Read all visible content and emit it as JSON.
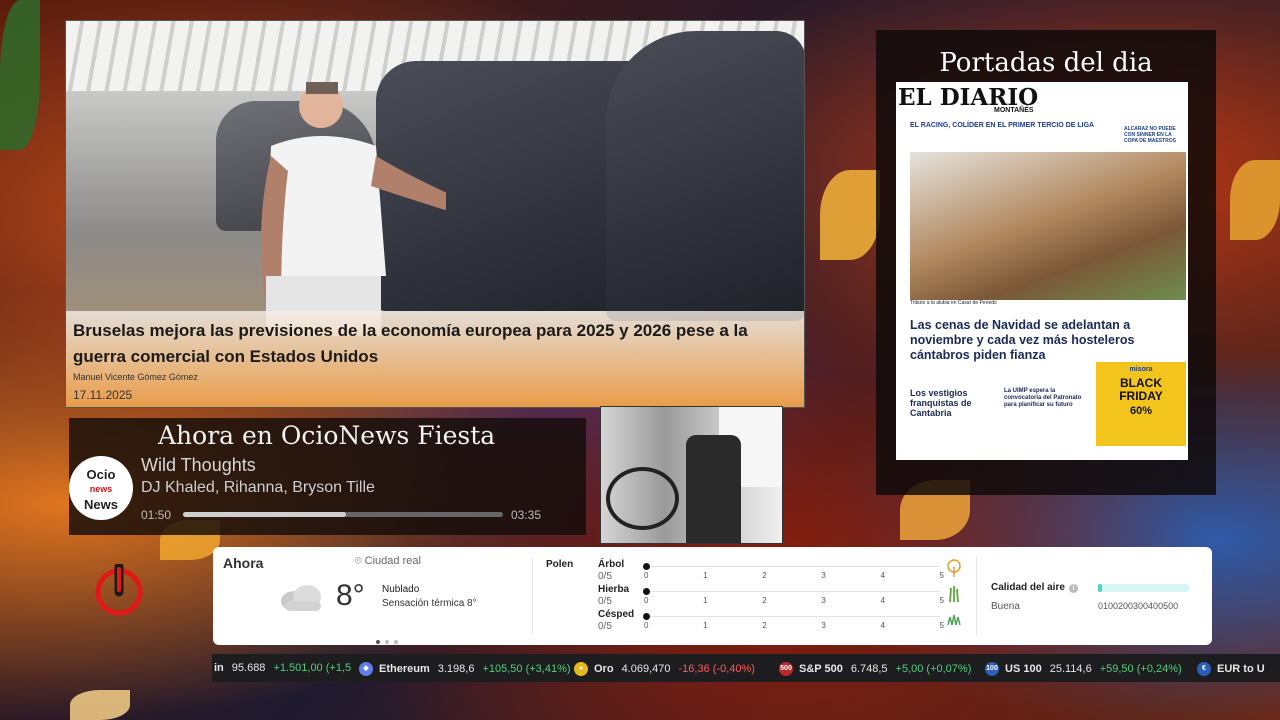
{
  "news": {
    "title": "Bruselas mejora las previsiones de la economía europea para 2025 y 2026 pese a la guerra comercial con Estados Unidos",
    "author": "Manuel Vicente Gómez Gómez",
    "date": "17.11.2025"
  },
  "portadas": {
    "title": "Portadas del dia",
    "paper_name": "EL DIARIO",
    "paper_sub": "MONTAÑÉS",
    "headline_top": "EL RACING, COLÍDER EN EL PRIMER TERCIO DE LIGA",
    "caption": "Tributo a la alubia en Casar de Periedo",
    "headline_main": "Las cenas de Navidad se adelantan a noviembre y cada vez más hosteleros cántabros piden fianza",
    "col_left": "Los vestigios franquistas de Cantabria",
    "col_mid": "La UIMP espera la convocatoria del Patronato para planificar su futuro",
    "right_top": "ALCARAZ NO PUEDE CON SINNER EN LA COPA DE MAESTROS",
    "ad_text": "BLACK FRIDAY",
    "ad_brand": "misora",
    "ad_pct": "60%"
  },
  "radio": {
    "title": "Ahora en OcioNews Fiesta",
    "logo_line1": "Ocio",
    "logo_line2": "news",
    "logo_line3": "News",
    "song": "Wild Thoughts",
    "artist": "DJ Khaled, Rihanna, Bryson Tille",
    "elapsed": "01:50",
    "duration": "03:35",
    "progress": 0.51
  },
  "weather": {
    "now_label": "Ahora",
    "city": "Ciudad real",
    "temp": "8°",
    "desc": "Nublado",
    "feels": "Sensación térmica 8°",
    "polen_label": "Polen",
    "polen": [
      {
        "name": "Árbol",
        "value": "0/5"
      },
      {
        "name": "Hierba",
        "value": "0/5"
      },
      {
        "name": "Césped",
        "value": "0/5"
      }
    ],
    "scale": [
      "0",
      "1",
      "2",
      "3",
      "4",
      "5"
    ],
    "air_label": "Calidad del aire",
    "air_state": "Buena",
    "air_scale": "0100200300400500"
  },
  "ticker": [
    {
      "name": "in",
      "value": "95.688",
      "change": "+1.501,00 (+1,5",
      "trend": "pos",
      "icon": "",
      "color": "#1d1c1f"
    },
    {
      "name": "Ethereum",
      "value": "3.198,6",
      "change": "+105,50 (+3,41%)",
      "trend": "pos",
      "icon": "◆",
      "color": "#627eea"
    },
    {
      "name": "Oro",
      "value": "4.069,470",
      "change": "-16,36 (-0,40%)",
      "trend": "neg",
      "icon": "●",
      "color": "#e5b820"
    },
    {
      "name": "S&P 500",
      "value": "6.748,5",
      "change": "+5,00 (+0,07%)",
      "trend": "pos",
      "icon": "500",
      "color": "#c0262d"
    },
    {
      "name": "US 100",
      "value": "25.114,6",
      "change": "+59,50 (+0,24%)",
      "trend": "pos",
      "icon": "100",
      "color": "#2a5fb8"
    },
    {
      "name": "EUR to U",
      "value": "",
      "change": "",
      "trend": "pos",
      "icon": "€",
      "color": "#2a5fb8"
    }
  ]
}
